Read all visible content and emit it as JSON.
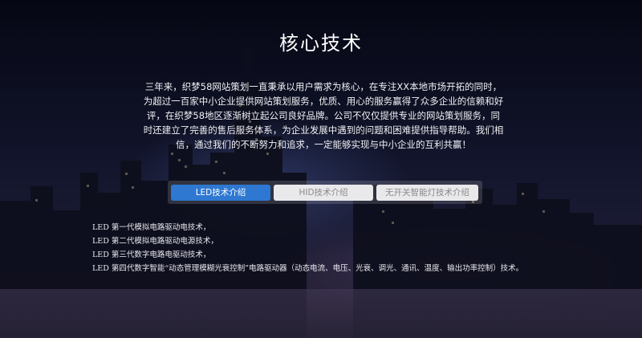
{
  "section": {
    "title": "核心技术",
    "intro": "三年来，织梦58网站策划一直秉承以用户需求为核心，在专注XX本地市场开拓的同时，为超过一百家中小企业提供网站策划服务，优质、用心的服务赢得了众多企业的信赖和好评，在织梦58地区逐渐树立起公司良好品牌。公司不仅仅提供专业的网站策划服务，同时还建立了完善的售后服务体系，为企业发展中遇到的问题和困难提供指导帮助。我们相信，通过我们的不断努力和追求，一定能够实现与中小企业的互利共赢！"
  },
  "tabs": [
    {
      "label": "LED技术介绍",
      "active": true
    },
    {
      "label": "HID技术介绍",
      "active": false
    },
    {
      "label": "无开关智能灯技术介绍",
      "active": false
    }
  ],
  "tech_list": [
    "LED 第一代模拟电路驱动电技术，",
    "LED 第二代模拟电路驱动电源技术，",
    "LED 第三代数字电路电驱动技术，",
    "LED 第四代数字智能“动态管理模糊光衰控制”电路驱动器（动态电流、电压、光衰、调光、通讯、温度、输出功率控制）技术。"
  ],
  "colors": {
    "active_tab": "#2e78d2",
    "inactive_tab": "#e9e9ec",
    "inactive_tab_text": "#8a8a8a"
  }
}
